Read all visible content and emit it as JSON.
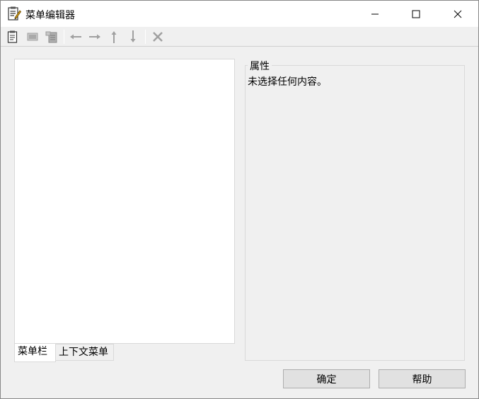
{
  "window": {
    "title": "菜单编辑器"
  },
  "toolbar": {
    "items": [
      {
        "icon": "new-item-icon",
        "enabled": true
      },
      {
        "icon": "new-separator-icon",
        "enabled": false
      },
      {
        "icon": "new-submenu-icon",
        "enabled": false
      },
      {
        "icon": "arrow-left-icon",
        "enabled": false
      },
      {
        "icon": "arrow-right-icon",
        "enabled": false
      },
      {
        "icon": "arrow-up-icon",
        "enabled": false
      },
      {
        "icon": "arrow-down-icon",
        "enabled": false
      },
      {
        "icon": "delete-icon",
        "enabled": false
      }
    ]
  },
  "tabs": {
    "menubar": "菜单栏",
    "context": "上下文菜单",
    "active": "菜单栏"
  },
  "properties": {
    "legend": "属性",
    "message": "未选择任何内容。"
  },
  "buttons": {
    "ok": "确定",
    "help": "帮助"
  },
  "colors": {
    "background": "#f0f0f0",
    "panel": "#ffffff",
    "disabled_icon": "#a0a0a0"
  }
}
